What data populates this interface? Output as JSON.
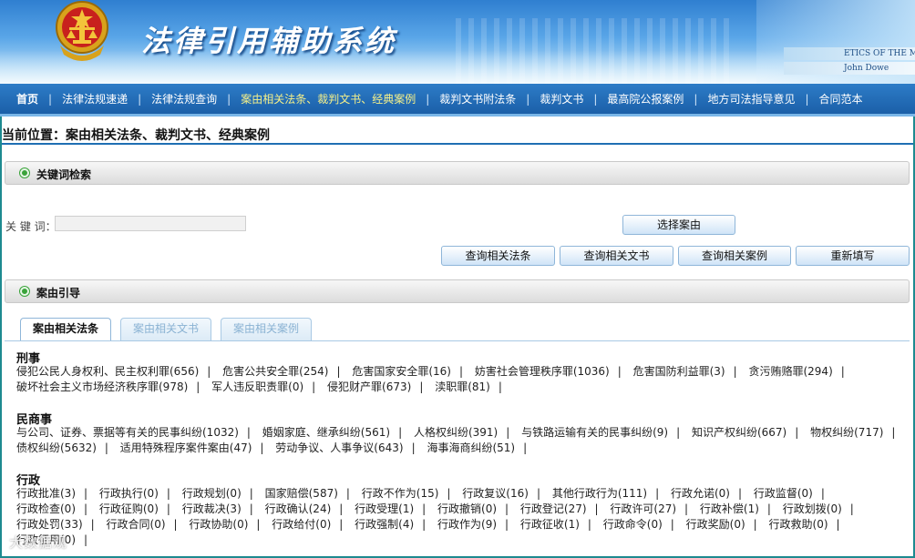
{
  "banner": {
    "title": "法律引用辅助系统",
    "books": [
      "ETICS OF THE MIDDLE ACES",
      "John Dowe"
    ]
  },
  "nav": {
    "items": [
      "首页",
      "法律法规速递",
      "法律法规查询",
      "案由相关法条、裁判文书、经典案例",
      "裁判文书附法条",
      "裁判文书",
      "最高院公报案例",
      "地方司法指导意见",
      "合同范本"
    ],
    "separator": "|"
  },
  "breadcrumb": "当前位置：案由相关法条、裁判文书、经典案例",
  "keyword_section": {
    "title": "关键词检索"
  },
  "search": {
    "label": "关 键 词：",
    "value": "",
    "choose_button": "选择案由",
    "buttons": [
      "查询相关法条",
      "查询相关文书",
      "查询相关案例",
      "重新填写"
    ]
  },
  "guide_section": {
    "title": "案由引导"
  },
  "tabs": [
    "案由相关法条",
    "案由相关文书",
    "案由相关案例"
  ],
  "categories": [
    {
      "name": "刑事",
      "items": [
        "侵犯公民人身权利、民主权利罪(656)",
        "危害公共安全罪(254)",
        "危害国家安全罪(16)",
        "妨害社会管理秩序罪(1036)",
        "危害国防利益罪(3)",
        "贪污贿赂罪(294)",
        "破坏社会主义市场经济秩序罪(978)",
        "军人违反职责罪(0)",
        "侵犯财产罪(673)",
        "渎职罪(81)"
      ]
    },
    {
      "name": "民商事",
      "items": [
        "与公司、证券、票据等有关的民事纠纷(1032)",
        "婚姻家庭、继承纠纷(561)",
        "人格权纠纷(391)",
        "与铁路运输有关的民事纠纷(9)",
        "知识产权纠纷(667)",
        "物权纠纷(717)",
        "债权纠纷(5632)",
        "适用特殊程序案件案由(47)",
        "劳动争议、人事争议(643)",
        "海事海商纠纷(51)"
      ]
    },
    {
      "name": "行政",
      "items": [
        "行政批准(3)",
        "行政执行(0)",
        "行政规划(0)",
        "国家赔偿(587)",
        "行政不作为(15)",
        "行政复议(16)",
        "其他行政行为(111)",
        "行政允诺(0)",
        "行政监督(0)",
        "行政检查(0)",
        "行政征购(0)",
        "行政裁决(3)",
        "行政确认(24)",
        "行政受理(1)",
        "行政撤销(0)",
        "行政登记(27)",
        "行政许可(27)",
        "行政补偿(1)",
        "行政划拨(0)",
        "行政处罚(33)",
        "行政合同(0)",
        "行政协助(0)",
        "行政给付(0)",
        "行政强制(4)",
        "行政作为(9)",
        "行政征收(1)",
        "行政命令(0)",
        "行政奖励(0)",
        "行政救助(0)",
        "行政征用(0)"
      ]
    }
  ],
  "watermark": "大数据观"
}
